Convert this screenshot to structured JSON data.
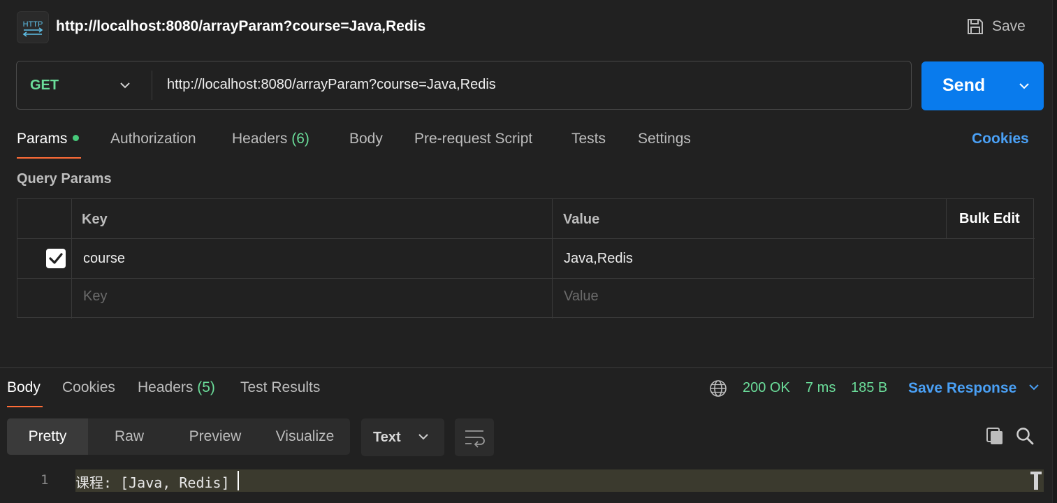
{
  "header": {
    "icon_label": "HTTP",
    "title": "http://localhost:8080/arrayParam?course=Java,Redis",
    "save_label": "Save"
  },
  "request": {
    "method": "GET",
    "url": "http://localhost:8080/arrayParam?course=Java,Redis",
    "send_label": "Send"
  },
  "tabs": [
    {
      "label": "Params"
    },
    {
      "label": "Authorization"
    },
    {
      "label": "Headers",
      "count": "(6)"
    },
    {
      "label": "Body"
    },
    {
      "label": "Pre-request Script"
    },
    {
      "label": "Tests"
    },
    {
      "label": "Settings"
    }
  ],
  "cookies_label": "Cookies",
  "query_params": {
    "title": "Query Params",
    "columns": {
      "key": "Key",
      "value": "Value",
      "bulk_edit": "Bulk Edit"
    },
    "rows": [
      {
        "checked": true,
        "key": "course",
        "value": "Java,Redis"
      }
    ],
    "placeholder": {
      "key": "Key",
      "value": "Value"
    }
  },
  "response": {
    "tabs": [
      {
        "label": "Body"
      },
      {
        "label": "Cookies"
      },
      {
        "label": "Headers",
        "count": "(5)"
      },
      {
        "label": "Test Results"
      }
    ],
    "status": "200 OK",
    "time": "7 ms",
    "size": "185 B",
    "save_response_label": "Save Response",
    "views": [
      "Pretty",
      "Raw",
      "Preview",
      "Visualize"
    ],
    "format": "Text",
    "lines": [
      {
        "number": "1",
        "text": "课程: [Java, Redis]"
      }
    ]
  },
  "colors": {
    "background": "#212121",
    "accent_blue": "#097bed",
    "link_blue": "#4aa0f5",
    "method_green": "#6bdd9a",
    "tab_underline": "#ff6c37"
  }
}
